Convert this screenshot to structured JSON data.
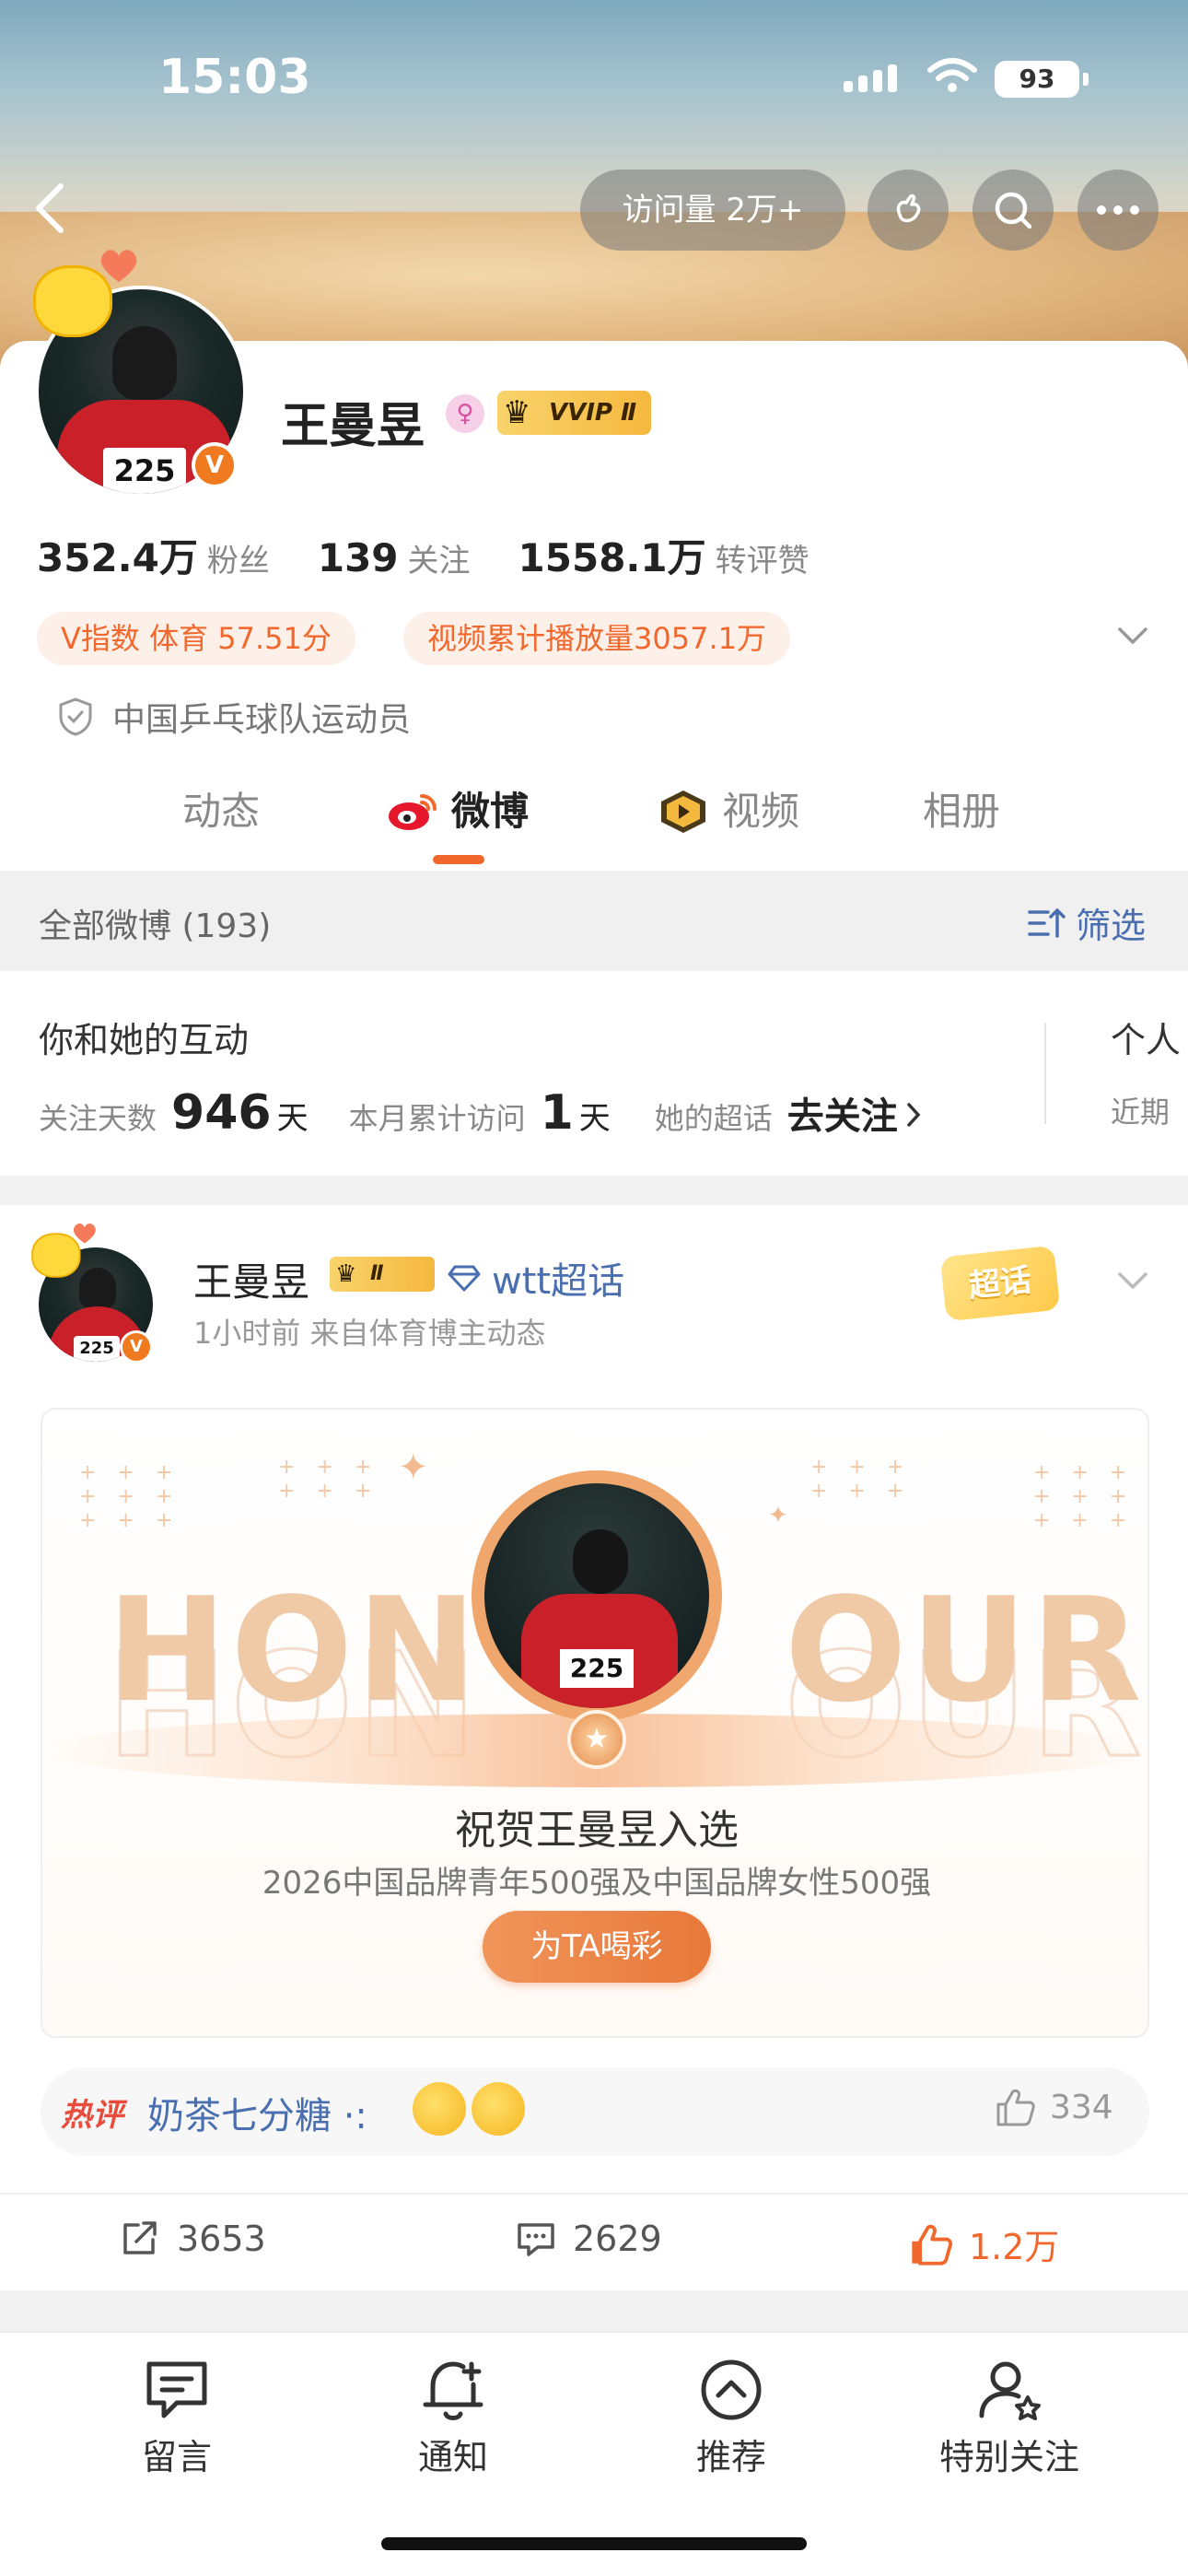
{
  "status": {
    "time": "15:03",
    "battery": "93"
  },
  "topnav": {
    "visits": "访问量 2万+"
  },
  "profile": {
    "name": "王曼昱",
    "gender_symbol": "♀",
    "vvip": "VVIP Ⅱ",
    "v_badge": "V",
    "stats": [
      {
        "num": "352.4万",
        "label": "粉丝"
      },
      {
        "num": "139",
        "label": "关注"
      },
      {
        "num": "1558.1万",
        "label": "转评赞"
      }
    ],
    "tags": [
      "V指数 体育 57.51分",
      "视频累计播放量3057.1万"
    ],
    "verified": "中国乒乓球队运动员",
    "jersey_number": "225"
  },
  "tabs": [
    {
      "label": "动态"
    },
    {
      "label": "微博"
    },
    {
      "label": "视频"
    },
    {
      "label": "相册"
    }
  ],
  "filterbar": {
    "all": "全部微博 (193)",
    "filter": "筛选"
  },
  "interaction": {
    "title": "你和她的互动",
    "follow_days_label": "关注天数",
    "follow_days": "946",
    "day_unit": "天",
    "visits_label": "本月累计访问",
    "visits": "1",
    "super_label": "她的超话",
    "super_action": "去关注",
    "side_title": "个人",
    "side_sub": "近期"
  },
  "post": {
    "author": "王曼昱",
    "badge": "Ⅱ",
    "topic": "wtt超话",
    "meta": "1小时前  来自体育博主动态",
    "sticker": "超话",
    "honour_left": "HON",
    "honour_right": "OUR",
    "headline": "祝贺王曼昱入选",
    "subline": "2026中国品牌青年500强及中国品牌女性500强",
    "cheer": "为TA喝彩",
    "hot_tag": "热评",
    "hot_user": "奶茶七分糖",
    "hot_sep": "·:",
    "hot_likes": "334",
    "reposts": "3653",
    "comments": "2629",
    "likes": "1.2万"
  },
  "bottombar": [
    {
      "label": "留言",
      "icon": "message-icon"
    },
    {
      "label": "通知",
      "icon": "bell-icon"
    },
    {
      "label": "推荐",
      "icon": "up-arrow-icon"
    },
    {
      "label": "特别关注",
      "icon": "user-star-icon"
    }
  ],
  "colors": {
    "accent": "#f2682c",
    "link": "#4a6fb0"
  }
}
